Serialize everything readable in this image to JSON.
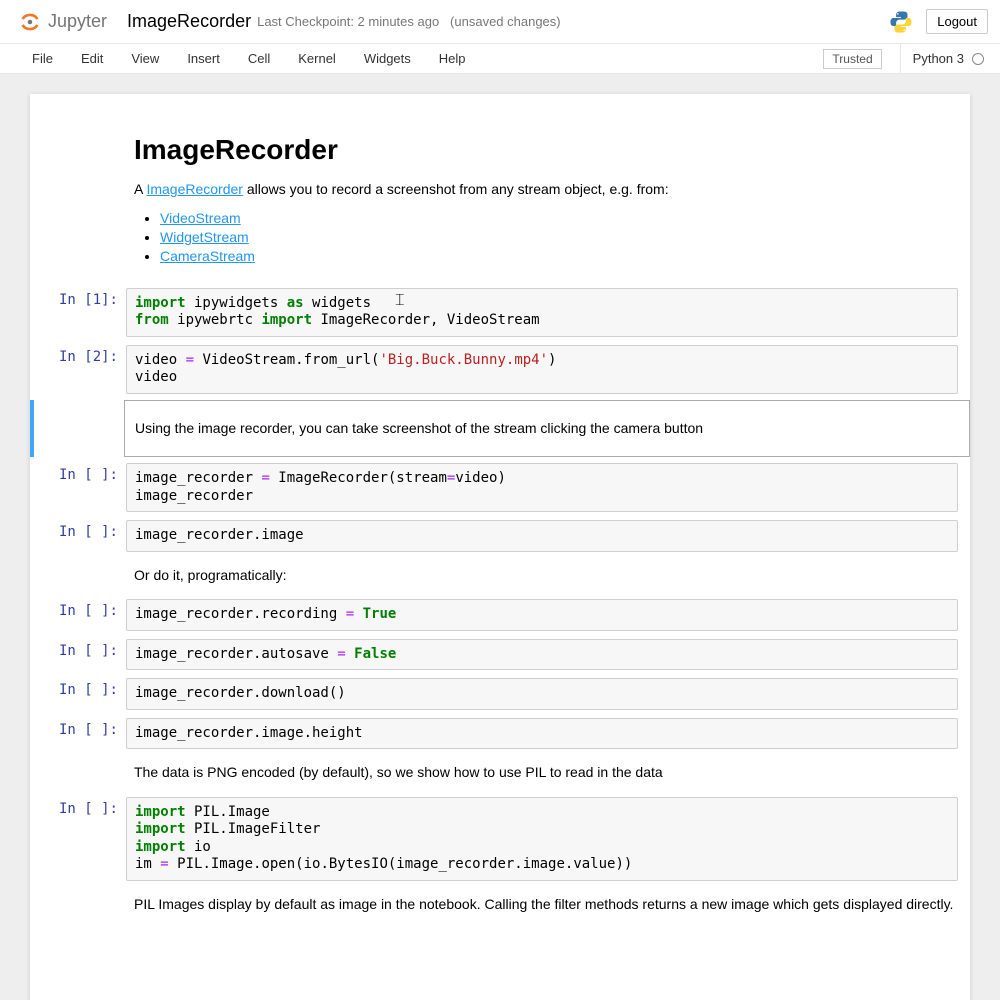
{
  "header": {
    "logo_text": "Jupyter",
    "notebook_name": "ImageRecorder",
    "checkpoint": "Last Checkpoint: 2 minutes ago",
    "unsaved": "(unsaved changes)",
    "logout": "Logout"
  },
  "menu": {
    "items": [
      "File",
      "Edit",
      "View",
      "Insert",
      "Cell",
      "Kernel",
      "Widgets",
      "Help"
    ],
    "trusted": "Trusted",
    "kernel": "Python 3"
  },
  "md0": {
    "title": "ImageRecorder",
    "intro_pre": "A ",
    "intro_link": "ImageRecorder",
    "intro_post": " allows you to record a screenshot from any stream object, e.g. from:",
    "links": [
      "VideoStream",
      "WidgetStream",
      "CameraStream"
    ]
  },
  "cells": {
    "p1": "In [1]:",
    "p2": "In [2]:",
    "pe": "In [ ]:",
    "c1_kw1": "import",
    "c1_txt1": " ipywidgets ",
    "c1_kw2": "as",
    "c1_txt2": " widgets\n",
    "c1_kw3": "from",
    "c1_txt3": " ipywebrtc ",
    "c1_kw4": "import",
    "c1_txt4": " ImageRecorder, VideoStream",
    "c2_txt1": "video ",
    "c2_op1": "=",
    "c2_txt2": " VideoStream.from_url(",
    "c2_str": "'Big.Buck.Bunny.mp4'",
    "c2_txt3": ")\nvideo",
    "md1": "Using the image recorder, you can take screenshot of the stream clicking the camera button",
    "c3_txt1": "image_recorder ",
    "c3_op": "=",
    "c3_txt2": " ImageRecorder(stream",
    "c3_op2": "=",
    "c3_txt3": "video)\nimage_recorder",
    "c4": "image_recorder.image",
    "md2": "Or do it, programatically:",
    "c5_txt": "image_recorder.recording ",
    "c5_op": "=",
    "c5_sp": " ",
    "c5_val": "True",
    "c6_txt": "image_recorder.autosave ",
    "c6_op": "=",
    "c6_sp": " ",
    "c6_val": "False",
    "c7": "image_recorder.download()",
    "c8": "image_recorder.image.height",
    "md3": "The data is PNG encoded (by default), so we show how to use PIL to read in the data",
    "c9_kw1": "import",
    "c9_t1": " PIL.Image\n",
    "c9_kw2": "import",
    "c9_t2": " PIL.ImageFilter\n",
    "c9_kw3": "import",
    "c9_t3": " io\nim ",
    "c9_op": "=",
    "c9_t4": " PIL.Image.open(io.BytesIO(image_recorder.image.value))",
    "md4": "PIL Images display by default as image in the notebook. Calling the filter methods returns a new image which gets displayed directly."
  }
}
